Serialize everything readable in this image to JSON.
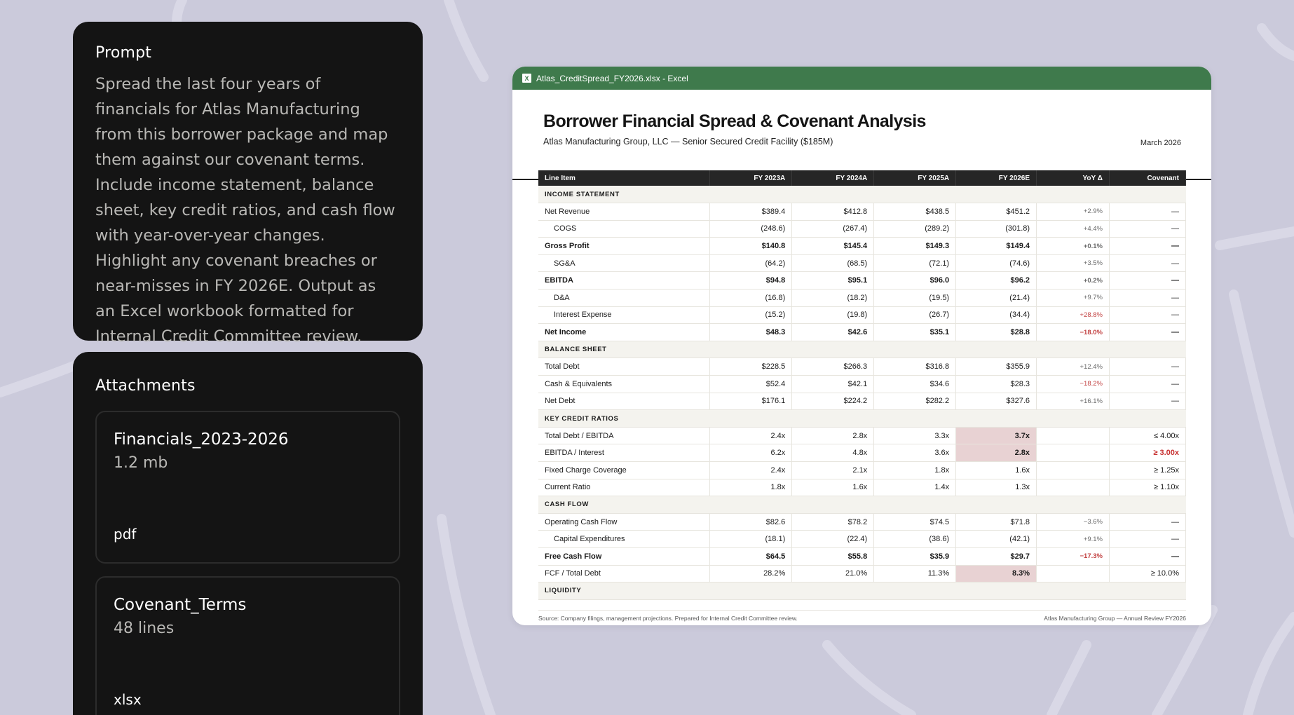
{
  "prompt": {
    "title": "Prompt",
    "text": "Spread the last four years of financials for Atlas Manufacturing from this borrower package and map them against our covenant terms. Include income statement, balance sheet, key credit ratios, and cash flow with year-over-year changes. Highlight any covenant breaches or near-misses in FY 2026E. Output as an Excel workbook formatted for Internal Credit Committee review."
  },
  "attachments": {
    "title": "Attachments",
    "files": [
      {
        "name": "Financials_2023-2026",
        "size": "1.2 mb",
        "ext": "pdf"
      },
      {
        "name": "Covenant_Terms",
        "size": "48 lines",
        "ext": "xlsx"
      }
    ]
  },
  "excel": {
    "window_title": "Atlas_CreditSpread_FY2026.xlsx - Excel",
    "icon_label": "X",
    "title": "Borrower Financial Spread & Covenant Analysis",
    "subtitle": "Atlas Manufacturing Group, LLC — Senior Secured Credit Facility ($185M)",
    "date": "March 2026",
    "columns": [
      "Line Item",
      "FY 2023A",
      "FY 2024A",
      "FY 2025A",
      "FY 2026E",
      "YoY Δ",
      "Covenant"
    ],
    "sections": {
      "income": "INCOME STATEMENT",
      "balance": "BALANCE SHEET",
      "ratios": "KEY CREDIT RATIOS",
      "cashflow": "CASH FLOW",
      "liquidity": "LIQUIDITY"
    },
    "rows": {
      "net_revenue": [
        "Net Revenue",
        "$389.4",
        "$412.8",
        "$438.5",
        "$451.2",
        "+2.9%",
        "—"
      ],
      "cogs": [
        "COGS",
        "(248.6)",
        "(267.4)",
        "(289.2)",
        "(301.8)",
        "+4.4%",
        "—"
      ],
      "gross_profit": [
        "Gross Profit",
        "$140.8",
        "$145.4",
        "$149.3",
        "$149.4",
        "+0.1%",
        "—"
      ],
      "sga": [
        "SG&A",
        "(64.2)",
        "(68.5)",
        "(72.1)",
        "(74.6)",
        "+3.5%",
        "—"
      ],
      "ebitda": [
        "EBITDA",
        "$94.8",
        "$95.1",
        "$96.0",
        "$96.2",
        "+0.2%",
        "—"
      ],
      "da": [
        "D&A",
        "(16.8)",
        "(18.2)",
        "(19.5)",
        "(21.4)",
        "+9.7%",
        "—"
      ],
      "interest": [
        "Interest Expense",
        "(15.2)",
        "(19.8)",
        "(26.7)",
        "(34.4)",
        "+28.8%",
        "—"
      ],
      "net_income": [
        "Net Income",
        "$48.3",
        "$42.6",
        "$35.1",
        "$28.8",
        "−18.0%",
        "—"
      ],
      "total_debt": [
        "Total Debt",
        "$228.5",
        "$266.3",
        "$316.8",
        "$355.9",
        "+12.4%",
        "—"
      ],
      "cash": [
        "Cash & Equivalents",
        "$52.4",
        "$42.1",
        "$34.6",
        "$28.3",
        "−18.2%",
        "—"
      ],
      "net_debt": [
        "Net Debt",
        "$176.1",
        "$224.2",
        "$282.2",
        "$327.6",
        "+16.1%",
        "—"
      ],
      "debt_ebitda": [
        "Total Debt / EBITDA",
        "2.4x",
        "2.8x",
        "3.3x",
        "3.7x",
        "",
        "≤ 4.00x"
      ],
      "ebitda_interest": [
        "EBITDA / Interest",
        "6.2x",
        "4.8x",
        "3.6x",
        "2.8x",
        "",
        "≥ 3.00x"
      ],
      "fcc": [
        "Fixed Charge Coverage",
        "2.4x",
        "2.1x",
        "1.8x",
        "1.6x",
        "",
        "≥ 1.25x"
      ],
      "current_ratio": [
        "Current Ratio",
        "1.8x",
        "1.6x",
        "1.4x",
        "1.3x",
        "",
        "≥ 1.10x"
      ],
      "ocf": [
        "Operating Cash Flow",
        "$82.6",
        "$78.2",
        "$74.5",
        "$71.8",
        "−3.6%",
        "—"
      ],
      "capex": [
        "Capital Expenditures",
        "(18.1)",
        "(22.4)",
        "(38.6)",
        "(42.1)",
        "+9.1%",
        "—"
      ],
      "fcf": [
        "Free Cash Flow",
        "$64.5",
        "$55.8",
        "$35.9",
        "$29.7",
        "−17.3%",
        "—"
      ],
      "fcf_debt": [
        "FCF / Total Debt",
        "28.2%",
        "21.0%",
        "11.3%",
        "8.3%",
        "",
        "≥ 10.0%"
      ]
    },
    "footer_left": "Source: Company filings, management projections. Prepared for Internal Credit Committee review.",
    "footer_right": "Atlas Manufacturing Group — Annual Review FY2026",
    "colors": {
      "titlebar": "#3f7a4c",
      "highlight": "#e8d2d3",
      "breach_text": "#c72f2f",
      "background": "#cbcadb"
    }
  }
}
